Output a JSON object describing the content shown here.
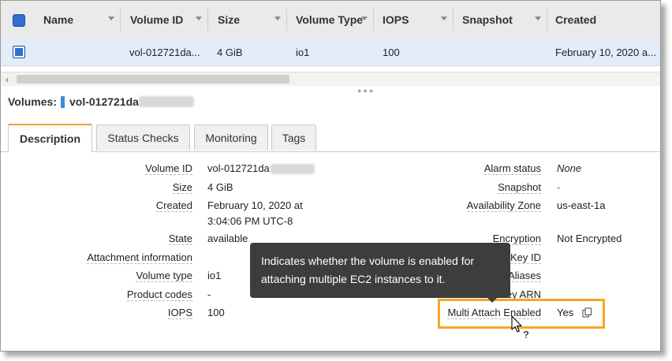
{
  "table": {
    "columns": [
      "Name",
      "Volume ID",
      "Size",
      "Volume Type",
      "IOPS",
      "Snapshot",
      "Created"
    ],
    "row": {
      "name": "",
      "volume_id": "vol-012721da...",
      "size": "4 GiB",
      "volume_type": "io1",
      "iops": "100",
      "snapshot": "",
      "created": "February 10, 2020 a..."
    }
  },
  "scrollbar": {
    "left_arrow": "‹"
  },
  "detail": {
    "title_label": "Volumes:",
    "title_value": "vol-012721da"
  },
  "tabs": [
    "Description",
    "Status Checks",
    "Monitoring",
    "Tags"
  ],
  "left_fields": [
    {
      "label": "Volume ID",
      "value": "vol-012721da"
    },
    {
      "label": "Size",
      "value": "4 GiB"
    },
    {
      "label": "Created",
      "value": "February 10, 2020 at",
      "value2": "3:04:06 PM UTC-8"
    },
    {
      "label": "State",
      "value": "available"
    },
    {
      "label": "Attachment information",
      "value": ""
    },
    {
      "label": "Volume type",
      "value": "io1"
    },
    {
      "label": "Product codes",
      "value": "-"
    },
    {
      "label": "IOPS",
      "value": "100"
    }
  ],
  "right_fields": [
    {
      "label": "Alarm status",
      "value": "None"
    },
    {
      "label": "Snapshot",
      "value": "-"
    },
    {
      "label": "Availability Zone",
      "value": "us-east-1a"
    },
    {
      "label": "Encryption",
      "value": "Not Encrypted"
    },
    {
      "label": "Key ID",
      "value": ""
    },
    {
      "label": "Aliases",
      "value": ""
    },
    {
      "label": "ey ARN",
      "value": ""
    },
    {
      "label": "Multi Attach Enabled",
      "value": "Yes"
    }
  ],
  "tooltip": {
    "line1": "Indicates whether the volume is enabled for",
    "line2": "attaching multiple EC2 instances to it."
  },
  "icons": {
    "copy": "copy-icon",
    "cursor": "help-cursor-icon"
  },
  "colors": {
    "highlight": "#f5a623",
    "tab_accent": "#f0a030",
    "checkbox": "#2f6fcf",
    "tooltip_bg": "#3d3d3d"
  }
}
